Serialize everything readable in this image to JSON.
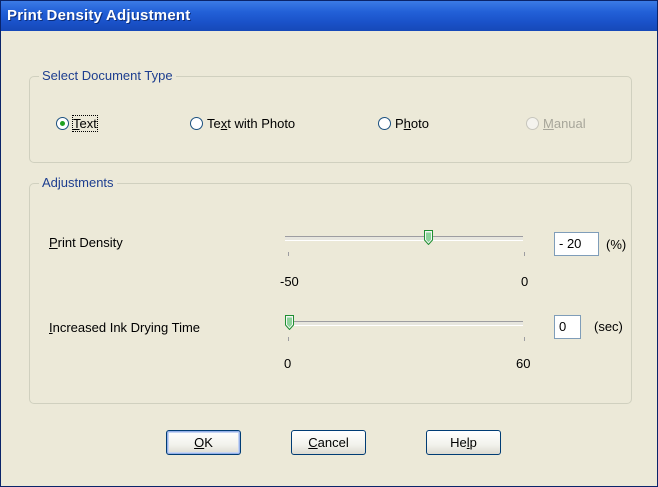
{
  "window": {
    "title": "Print Density Adjustment"
  },
  "document_type": {
    "legend": "Select Document Type",
    "options": [
      {
        "pre": "",
        "accel": "T",
        "post": "ext",
        "selected": true,
        "enabled": true
      },
      {
        "pre": "Te",
        "accel": "x",
        "post": "t with Photo",
        "selected": false,
        "enabled": true
      },
      {
        "pre": "P",
        "accel": "h",
        "post": "oto",
        "selected": false,
        "enabled": true
      },
      {
        "pre": "",
        "accel": "M",
        "post": "anual",
        "selected": false,
        "enabled": false
      }
    ]
  },
  "adjustments": {
    "legend": "Adjustments",
    "print_density": {
      "label_accel": "P",
      "label_rest": "rint Density",
      "min_label": "-50",
      "max_label": "0",
      "value": "- 20",
      "unit": "(%)",
      "min": -50,
      "max": 0,
      "current": -20
    },
    "drying_time": {
      "label_accel": "I",
      "label_rest": "ncreased Ink Drying Time",
      "min_label": "0",
      "max_label": "60",
      "value": "0",
      "unit": "(sec)",
      "min": 0,
      "max": 60,
      "current": 0
    }
  },
  "buttons": {
    "ok": {
      "accel": "O",
      "rest": "K"
    },
    "cancel": {
      "accel": "C",
      "rest": "ancel"
    },
    "help": {
      "pre": "He",
      "accel": "l",
      "post": "p"
    }
  },
  "colors": {
    "titlebar": "#2361d8",
    "dialog_bg": "#ece9d8",
    "group_legend": "#1d3e8f",
    "radio_dot": "#21a121",
    "button_border": "#003c74"
  }
}
